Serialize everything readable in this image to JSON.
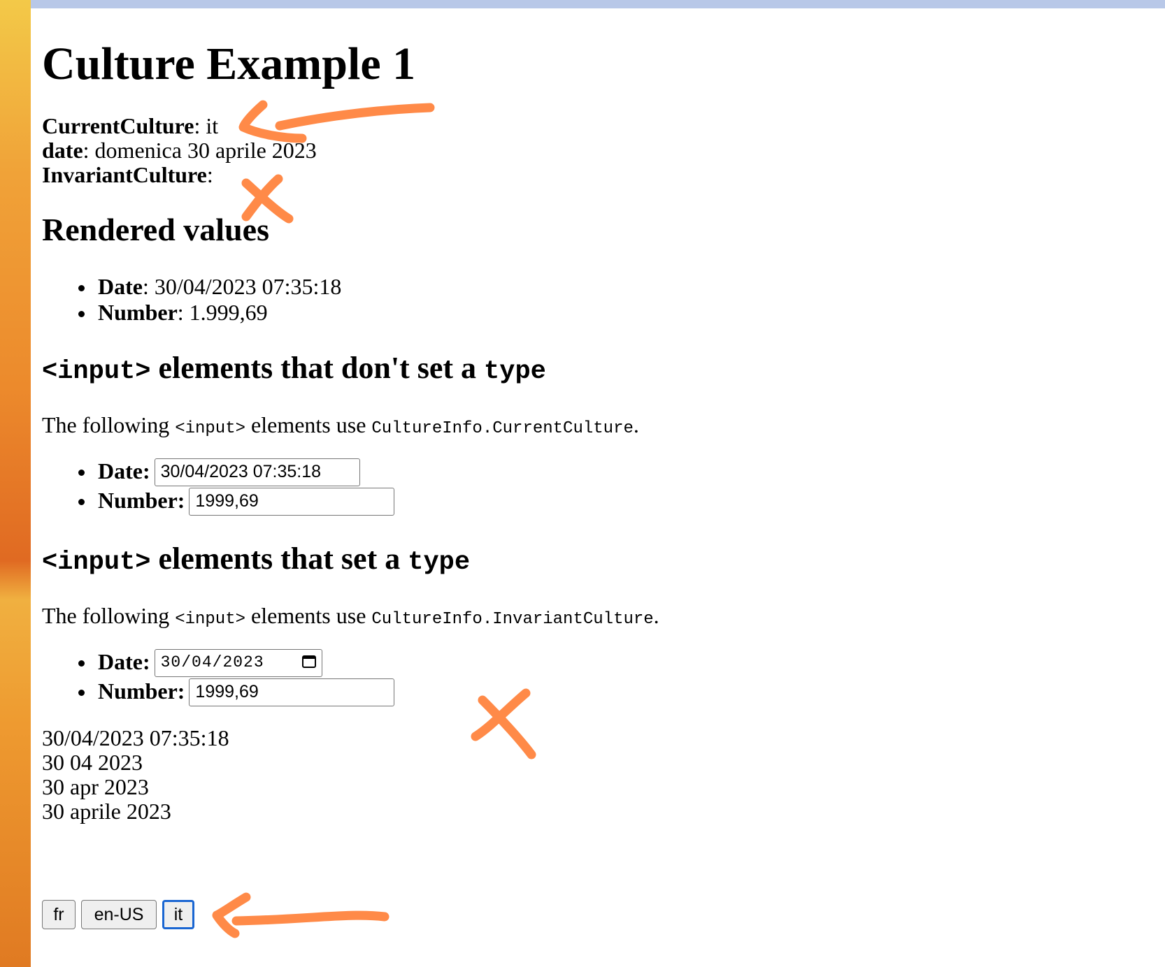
{
  "title": "Culture Example 1",
  "info": {
    "current_culture_label": "CurrentCulture",
    "current_culture_value": ": it",
    "date_label": "date",
    "date_value": ": domenica 30 aprile 2023",
    "invariant_label": "InvariantCulture",
    "invariant_value": ":"
  },
  "rendered": {
    "heading": "Rendered values",
    "items": [
      {
        "label": "Date",
        "value": ": 30/04/2023 07:35:18"
      },
      {
        "label": "Number",
        "value": ": 1.999,69"
      }
    ]
  },
  "section_untyped": {
    "heading_code": "<input>",
    "heading_text": " elements that don't set a ",
    "heading_type": "type",
    "para_prefix": "The following ",
    "para_code": "<input>",
    "para_mid": " elements use ",
    "para_culture": "CultureInfo.CurrentCulture",
    "para_suffix": ".",
    "date_label": "Date:",
    "date_value": "30/04/2023 07:35:18",
    "number_label": "Number:",
    "number_value": "1999,69"
  },
  "section_typed": {
    "heading_code": "<input>",
    "heading_text": " elements that set a ",
    "heading_type": "type",
    "para_prefix": "The following ",
    "para_code": "<input>",
    "para_mid": " elements use ",
    "para_culture": "CultureInfo.InvariantCulture",
    "para_suffix": ".",
    "date_label": "Date:",
    "date_value": "30/04/2023",
    "number_label": "Number:",
    "number_value": "1999,69"
  },
  "outputs": [
    "30/04/2023 07:35:18",
    "30 04 2023",
    "30 apr 2023",
    "30 aprile 2023"
  ],
  "culture_buttons": [
    {
      "label": "fr",
      "selected": false
    },
    {
      "label": "en-US",
      "selected": false
    },
    {
      "label": "it",
      "selected": true
    }
  ],
  "colors": {
    "annotation": "#ff8a48",
    "focus_ring": "#1a66d2",
    "top_bar": "#b8c8e8"
  }
}
